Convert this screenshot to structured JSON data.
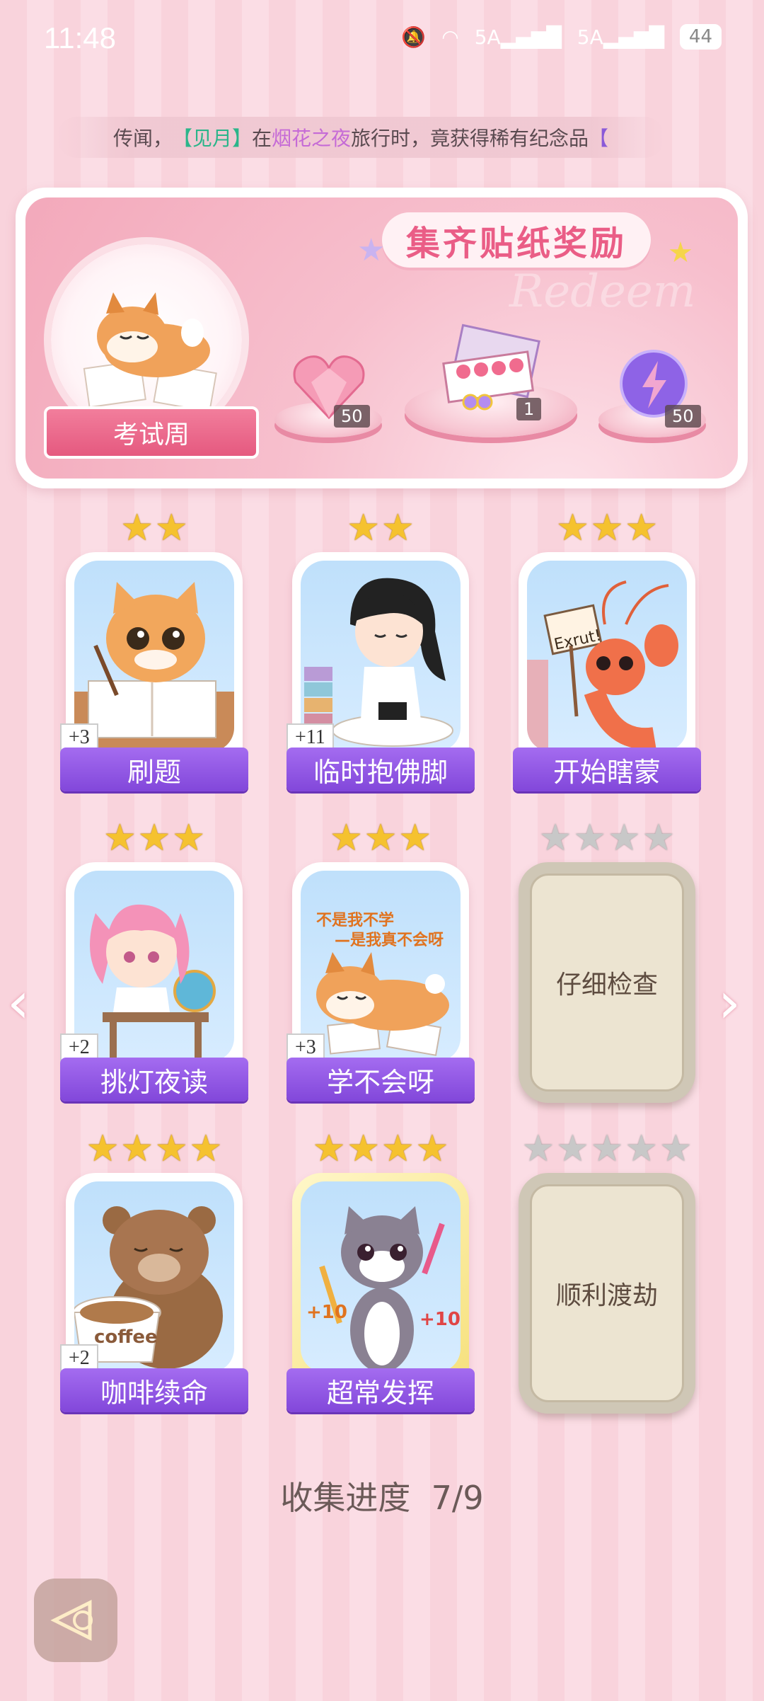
{
  "status": {
    "time": "11:48",
    "net1": "5A",
    "net2": "5A",
    "battery": "44"
  },
  "ticker": {
    "prefix": "传闻，",
    "name": "【见月】",
    "mid1": "在",
    "place": "烟花之夜",
    "mid2": "旅行时，竟获得稀有纪念品",
    "tail": "【"
  },
  "banner": {
    "title": "集齐贴纸奖励",
    "watermark": "Redeem",
    "badge_label": "考试周",
    "rewards": [
      {
        "icon": "pink-heart-gem-icon",
        "count": "50"
      },
      {
        "icon": "gift-box-icon",
        "count": "1"
      },
      {
        "icon": "purple-lightning-orb-icon",
        "count": "50"
      }
    ]
  },
  "stickers": [
    {
      "label": "刷题",
      "bonus": "+3",
      "stars": 2,
      "collected": true
    },
    {
      "label": "临时抱佛脚",
      "bonus": "+11",
      "stars": 2,
      "collected": true
    },
    {
      "label": "开始瞎蒙",
      "stars": 3,
      "collected": true,
      "sign": "Exrut!"
    },
    {
      "label": "挑灯夜读",
      "bonus": "+2",
      "stars": 3,
      "collected": true
    },
    {
      "label": "学不会呀",
      "bonus": "+3",
      "stars": 3,
      "collected": true,
      "caption1": "不是我不学",
      "caption2": "—是我真不会呀"
    },
    {
      "label": "仔细检查",
      "stars": 4,
      "collected": false
    },
    {
      "label": "咖啡续命",
      "bonus": "+2",
      "stars": 4,
      "collected": true,
      "cup": "coffee"
    },
    {
      "label": "超常发挥",
      "stars": 4,
      "collected": true,
      "score": "+10"
    },
    {
      "label": "顺利渡劫",
      "stars": 5,
      "collected": false
    }
  ],
  "progress": {
    "label": "收集进度",
    "value": "7/9"
  },
  "nav": {
    "prev": "‹",
    "next": "›"
  }
}
